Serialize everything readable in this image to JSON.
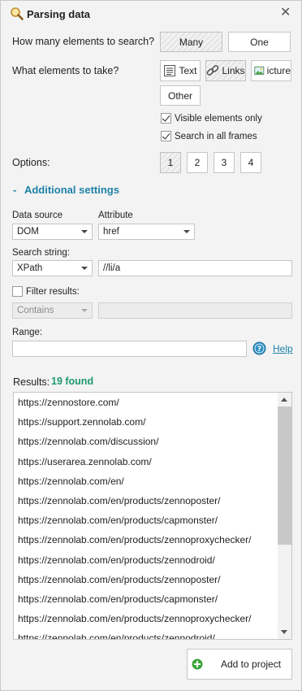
{
  "window": {
    "title": "Parsing data",
    "close_glyph": "✕"
  },
  "search_count": {
    "label": "How many elements to search?",
    "options": [
      "Many",
      "One"
    ],
    "selected": "Many"
  },
  "take": {
    "label": "What elements to take?",
    "options": [
      {
        "label": "Text",
        "icon": "text-lines-icon"
      },
      {
        "label": "Links",
        "icon": "chain-link-icon",
        "active": true
      },
      {
        "label": "icture",
        "icon": "picture-icon"
      },
      {
        "label": "Other",
        "icon": ""
      }
    ]
  },
  "checks": {
    "visible_only": {
      "label": "Visible elements only",
      "checked": true
    },
    "all_frames": {
      "label": "Search in all frames",
      "checked": true
    }
  },
  "options_row": {
    "label": "Options:",
    "buttons": [
      "1",
      "2",
      "3",
      "4"
    ],
    "selected": "1"
  },
  "additional": {
    "toggle": "-",
    "title": "Additional settings"
  },
  "data_source": {
    "label": "Data source",
    "value": "DOM"
  },
  "attribute": {
    "label": "Attribute",
    "value": "href"
  },
  "search_string": {
    "label": "Search string:",
    "type": "XPath",
    "value": "//li/a"
  },
  "filter": {
    "label": "Filter results:",
    "checked": false,
    "mode": "Contains",
    "value": ""
  },
  "range": {
    "label": "Range:",
    "value": "",
    "help": "Help"
  },
  "results": {
    "label": "Results:",
    "count_text": "19 found",
    "items": [
      "https://zennostore.com/",
      "https://support.zennolab.com/",
      "https://zennolab.com/discussion/",
      "https://userarea.zennolab.com/",
      "https://zennolab.com/en/",
      "https://zennolab.com/en/products/zennoposter/",
      "https://zennolab.com/en/products/capmonster/",
      "https://zennolab.com/en/products/zennoproxychecker/",
      "https://zennolab.com/en/products/zennodroid/",
      "https://zennolab.com/en/products/zennoposter/",
      "https://zennolab.com/en/products/capmonster/",
      "https://zennolab.com/en/products/zennoproxychecker/",
      "https://zennolab.com/en/products/zennodroid/"
    ]
  },
  "add_button": {
    "label": "Add to project",
    "icon": "green-plus-icon"
  },
  "colors": {
    "accent": "#1e82a8",
    "found": "#1e9a6e",
    "add_icon": "#3aa53a"
  }
}
